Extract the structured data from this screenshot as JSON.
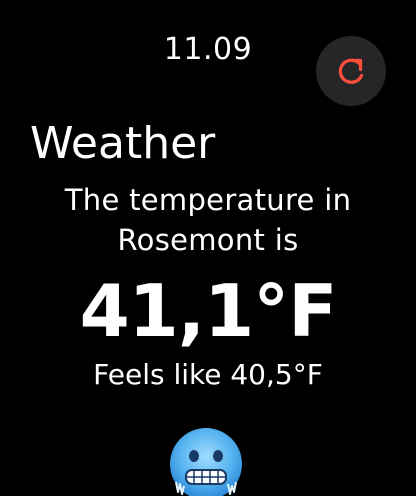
{
  "status": {
    "time": "11.09"
  },
  "actions": {
    "refresh_icon": "refresh-icon",
    "accent_color": "#ff4f3a"
  },
  "weather": {
    "title": "Weather",
    "message_line1": "The temperature in",
    "message_line2": "Rosemont is",
    "temperature": "41,1°F",
    "feels_like": "Feels like 40,5°F",
    "condition_icon": "freezing-face-icon"
  }
}
